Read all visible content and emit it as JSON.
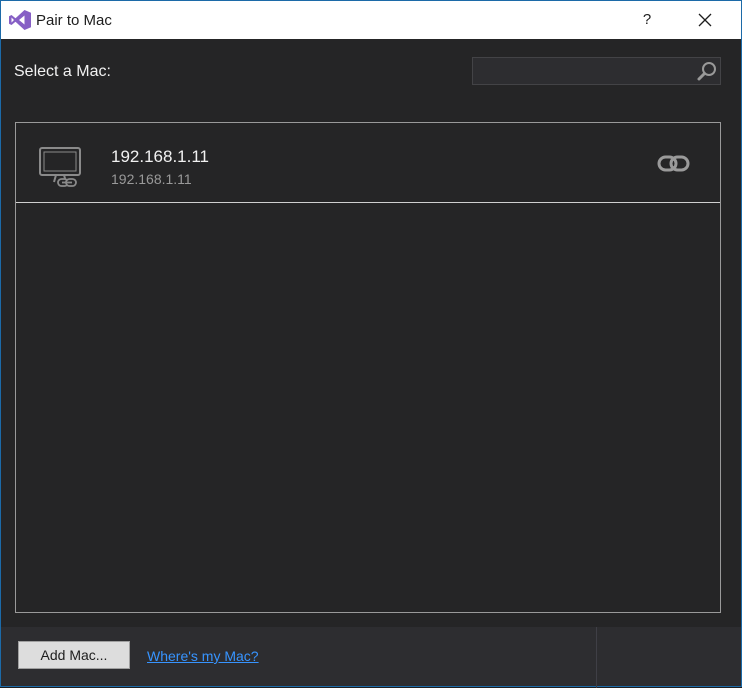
{
  "window": {
    "title": "Pair to Mac",
    "help_label": "?"
  },
  "content": {
    "select_label": "Select a Mac:",
    "search": {
      "value": "",
      "placeholder": ""
    }
  },
  "macs": [
    {
      "name": "192.168.1.11",
      "address": "192.168.1.11",
      "icon": "mac-monitor-icon",
      "status_icon": "link-icon"
    }
  ],
  "footer": {
    "add_button_label": "Add Mac...",
    "help_link_label": "Where's my Mac?"
  },
  "colors": {
    "accent": "#68217a",
    "link": "#3794ff",
    "background": "#252526"
  }
}
